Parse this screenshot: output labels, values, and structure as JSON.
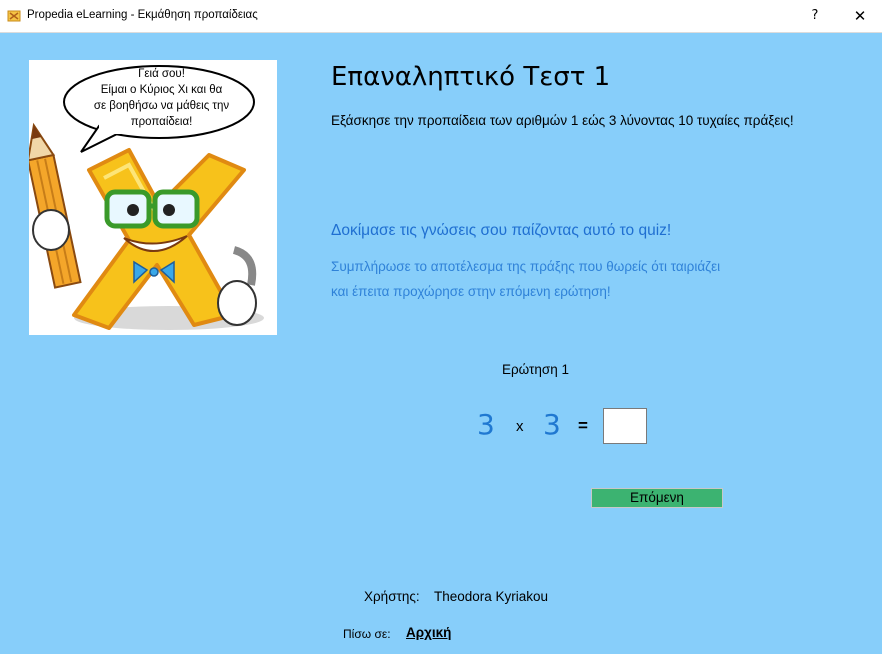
{
  "window": {
    "title": "Propedia eLearning - Εκμάθηση προπαίδειας",
    "help_label": "?",
    "close_label": "✕",
    "app_icon": "propedia-logo-icon"
  },
  "mascot": {
    "speech_lines": [
      "Γειά σου!",
      "Είμαι ο Κύριος Χι και θα",
      "σε βοηθήσω να μάθεις την",
      "προπαίδεια!"
    ],
    "colors": {
      "x_body": "#f7c21b",
      "x_outline": "#e08a12",
      "pencil": "#f4a62a"
    }
  },
  "main": {
    "heading": "Επαναληπτικό Τεστ 1",
    "subtitle": "Εξάσκησε την προπαίδεια των αριθμών 1 εώς 3 λύνοντας 10 τυχαίες πράξεις!",
    "quiz_heading": "Δοκίμασε τις γνώσεις σου παίζοντας αυτό το quiz!",
    "instruction_line1": "Συμπλήρωσε το αποτέλεσμα της πράξης που θωρείς ότι ταιριάζει",
    "instruction_line2": "και έπειτα προχώρησε στην επόμενη ερώτηση!"
  },
  "question": {
    "label": "Ερώτηση",
    "number": "1",
    "operand_a": "3",
    "operator": "x",
    "operand_b": "3",
    "equals": "=",
    "answer_value": "",
    "next_label": "Επόμενη"
  },
  "footer": {
    "user_label": "Χρήστης:",
    "user_name": "Theodora Kyriakou",
    "back_label": "Πίσω σε:",
    "home_link": "Αρχική"
  },
  "colors": {
    "background": "#87cefa",
    "accent_blue": "#1f78d1",
    "next_button": "#3cb371"
  }
}
